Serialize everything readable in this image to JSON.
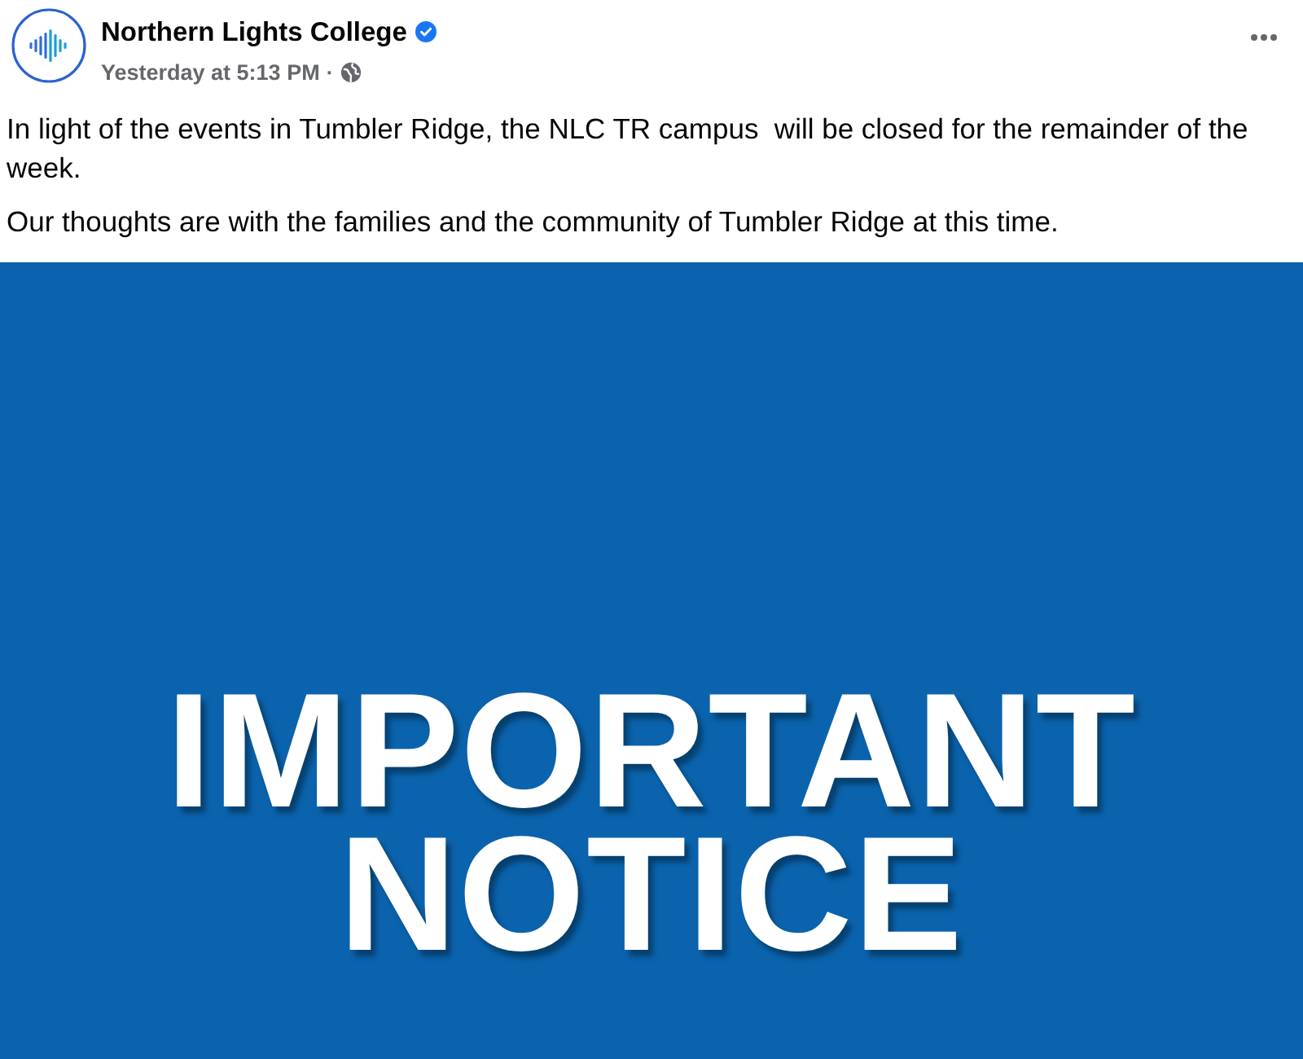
{
  "post": {
    "author": "Northern Lights College",
    "verified": true,
    "time": "Yesterday at 5:13 PM",
    "separator": "·",
    "paragraphs": [
      "In light of the events in Tumbler Ridge, the NLC TR campus  will be closed for the remainder of the week.",
      "Our thoughts are with the families and the community of Tumbler Ridge at this time."
    ]
  },
  "image": {
    "lines": [
      "IMPORTANT",
      "NOTICE"
    ]
  }
}
